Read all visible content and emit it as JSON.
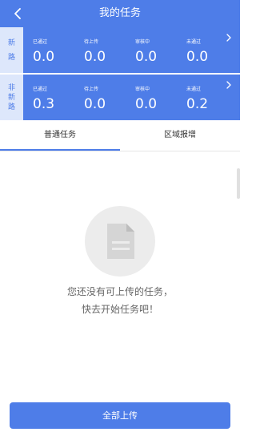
{
  "header": {
    "title": "我的任务"
  },
  "stats": {
    "rows": [
      {
        "label_chars": [
          "新",
          "路"
        ],
        "items": [
          {
            "label": "已通过",
            "value": "0.0"
          },
          {
            "label": "待上传",
            "value": "0.0"
          },
          {
            "label": "审核中",
            "value": "0.0"
          },
          {
            "label": "未通过",
            "value": "0.0"
          }
        ]
      },
      {
        "label_chars": [
          "非",
          "新",
          "路"
        ],
        "items": [
          {
            "label": "已通过",
            "value": "0.3"
          },
          {
            "label": "待上传",
            "value": "0.0"
          },
          {
            "label": "审核中",
            "value": "0.0"
          },
          {
            "label": "未通过",
            "value": "0.2"
          }
        ]
      }
    ]
  },
  "tabs": [
    {
      "label": "普通任务",
      "active": true
    },
    {
      "label": "区域报增",
      "active": false
    }
  ],
  "empty_state": {
    "line1": "您还没有可上传的任务，",
    "line2": "快去开始任务吧！",
    "icon": "document-icon"
  },
  "footer": {
    "upload_all_label": "全部上传"
  },
  "colors": {
    "accent": "#4e7de8",
    "label_bg": "#dde7fb",
    "empty_icon_bg": "#ececec"
  }
}
